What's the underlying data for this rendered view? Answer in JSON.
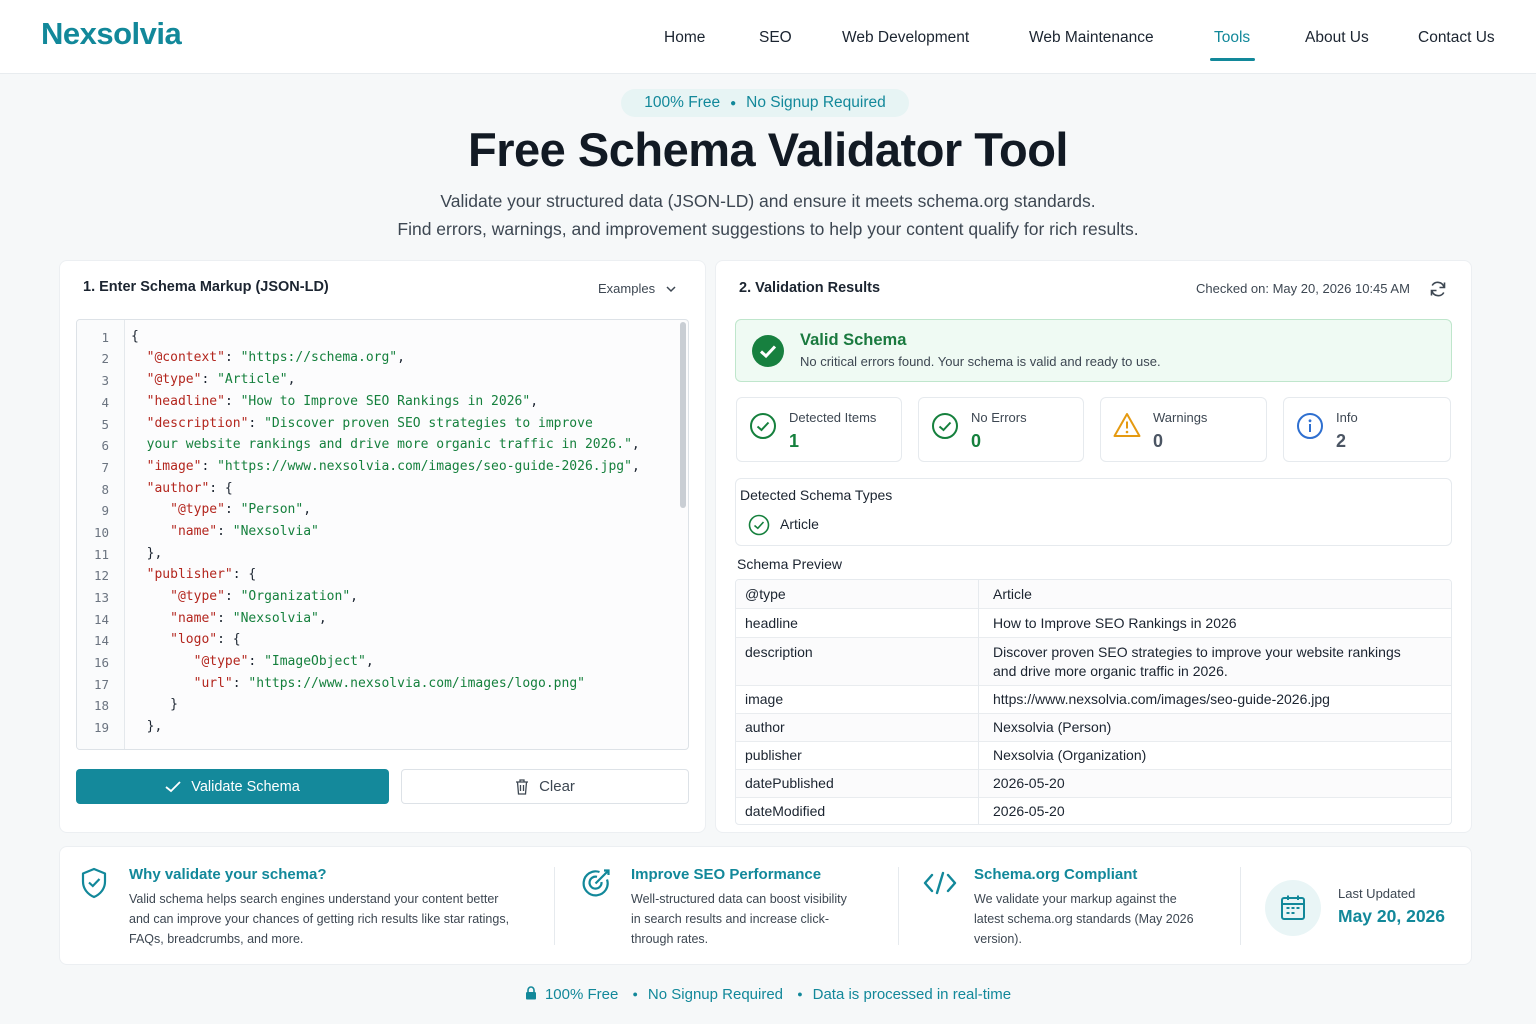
{
  "brand": {
    "name": "Nexsolvia"
  },
  "nav": {
    "items": [
      "Home",
      "SEO",
      "Web Development",
      "Web Maintenance",
      "Tools",
      "About Us",
      "Contact Us"
    ],
    "active": "Tools"
  },
  "hero": {
    "pill_left": "100% Free",
    "pill_right": "No Signup Required",
    "title": "Free Schema Validator Tool",
    "subtitle_1": "Validate your structured data (JSON-LD) and ensure it meets schema.org standards.",
    "subtitle_2": "Find errors, warnings, and improvement suggestions to help your content qualify for rich results."
  },
  "input_panel": {
    "title": "1. Enter Schema Markup (JSON-LD)",
    "examples_label": "Examples",
    "line_numbers": [
      "1",
      "2",
      "3",
      "4",
      "5",
      "6",
      "7",
      "8",
      "9",
      "10",
      "11",
      "12",
      "13",
      "14",
      "14",
      "16",
      "17",
      "18",
      "19"
    ],
    "validate_label": "Validate Schema",
    "clear_label": "Clear"
  },
  "results_panel": {
    "title": "2. Validation Results",
    "checked_on": "Checked on: May 20, 2026 10:45 AM",
    "status_title": "Valid Schema",
    "status_desc": "No critical errors found. Your schema is valid and ready to use.",
    "stats": [
      {
        "label": "Detected Items",
        "value": "1",
        "icon": "check-circle-icon",
        "color": "#15803d"
      },
      {
        "label": "No Errors",
        "value": "0",
        "icon": "check-circle-icon",
        "color": "#15803d"
      },
      {
        "label": "Warnings",
        "value": "0",
        "icon": "warning-icon",
        "color": "#4b5563"
      },
      {
        "label": "Info",
        "value": "2",
        "icon": "info-icon",
        "color": "#4b5563"
      }
    ],
    "types_title": "Detected Schema Types",
    "types": [
      "Article"
    ],
    "preview_title": "Schema Preview",
    "preview_rows": [
      {
        "key": "@type",
        "value": "Article"
      },
      {
        "key": "headline",
        "value": "How to Improve SEO Rankings in 2026"
      },
      {
        "key": "description",
        "value": "Discover proven SEO strategies to improve your website rankings",
        "value2": "and drive more organic traffic in 2026."
      },
      {
        "key": "image",
        "value": "https://www.nexsolvia.com/images/seo-guide-2026.jpg"
      },
      {
        "key": "author",
        "value": "Nexsolvia (Person)"
      },
      {
        "key": "publisher",
        "value": "Nexsolvia (Organization)"
      },
      {
        "key": "datePublished",
        "value": "2026-05-20"
      },
      {
        "key": "dateModified",
        "value": "2026-05-20"
      }
    ]
  },
  "info": {
    "why_title": "Why validate your schema?",
    "why_text_1": "Valid schema helps search engines understand your content better",
    "why_text_2": "and can improve your chances of getting rich results like star ratings,",
    "why_text_3": "FAQs, breadcrumbs, and more.",
    "seo_title": "Improve SEO Performance",
    "seo_text_1": "Well-structured data can boost visibility",
    "seo_text_2": "in search results and increase click-",
    "seo_text_3": "through rates.",
    "compliant_title": "Schema.org Compliant",
    "compliant_text_1": "We validate your markup against the",
    "compliant_text_2": "latest schema.org standards (May 2026",
    "compliant_text_3": "version).",
    "updated_label": "Last Updated",
    "updated_value": "May 20, 2026"
  },
  "footer": {
    "item_1": "100% Free",
    "item_2": "No Signup Required",
    "item_3": "Data is processed in real-time"
  },
  "colors": {
    "accent": "#12889a",
    "success": "#1a7a3f",
    "key": "#b3261e",
    "string": "#15803d"
  }
}
